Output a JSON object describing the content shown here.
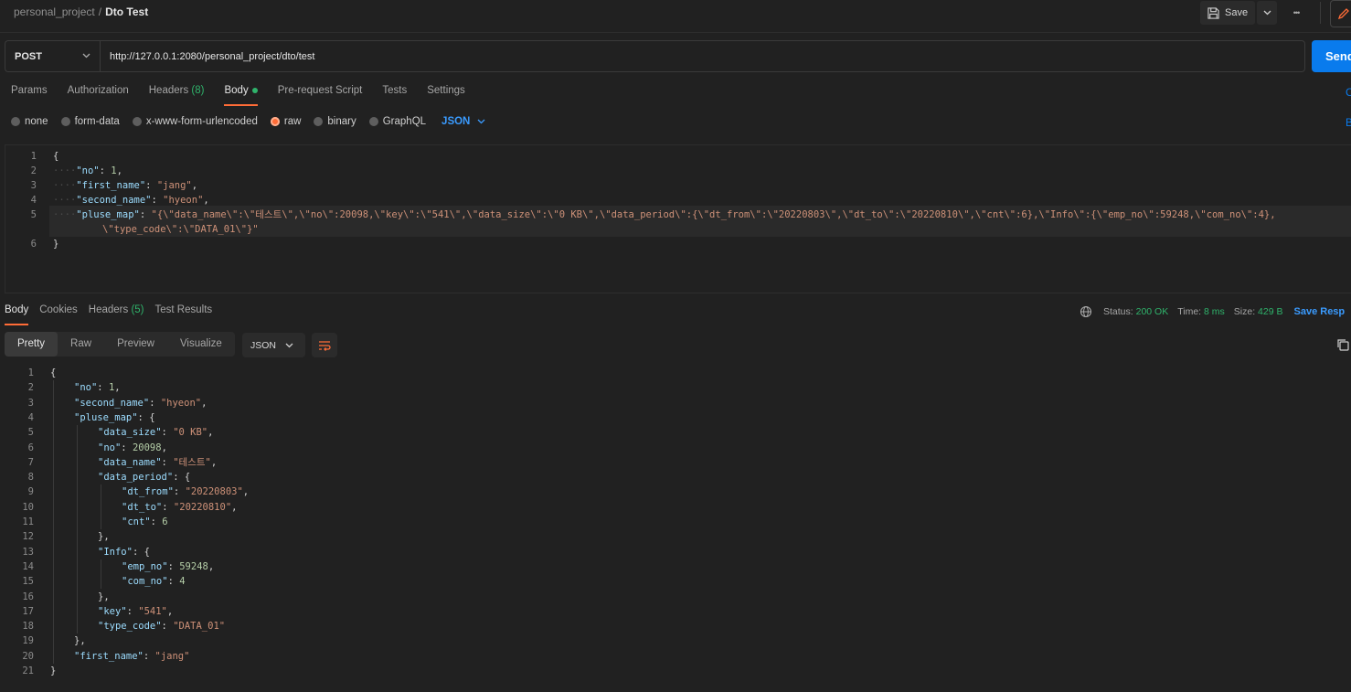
{
  "breadcrumb": {
    "workspace": "personal_project",
    "separator": "/",
    "request": "Dto Test"
  },
  "toolbar": {
    "save_label": "Save",
    "more_label": "•••"
  },
  "request": {
    "method": "POST",
    "url": "http://127.0.0.1:2080/personal_project/dto/test",
    "send_label": "Send"
  },
  "request_tabs": [
    {
      "label": "Params"
    },
    {
      "label": "Authorization"
    },
    {
      "label": "Headers",
      "count": "(8)"
    },
    {
      "label": "Body"
    },
    {
      "label": "Pre-request Script"
    },
    {
      "label": "Tests"
    },
    {
      "label": "Settings"
    }
  ],
  "request_tabs_right_clipped": "C",
  "body_types": [
    {
      "label": "none"
    },
    {
      "label": "form-data"
    },
    {
      "label": "x-www-form-urlencoded"
    },
    {
      "label": "raw"
    },
    {
      "label": "binary"
    },
    {
      "label": "GraphQL"
    }
  ],
  "body_format": "JSON",
  "body_types_right_clipped": "B",
  "request_body_lines": [
    {
      "n": "1",
      "text": "{"
    },
    {
      "n": "2",
      "key": "\"no\"",
      "value": "1",
      "vtype": "num",
      "tail": ","
    },
    {
      "n": "3",
      "key": "\"first_name\"",
      "value": "\"jang\"",
      "vtype": "str",
      "tail": ","
    },
    {
      "n": "4",
      "key": "\"second_name\"",
      "value": "\"hyeon\"",
      "vtype": "str",
      "tail": ","
    },
    {
      "n": "5",
      "key": "\"pluse_map\"",
      "value": "\"{\\\"data_name\\\":\\\"테스트\\\",\\\"no\\\":20098,\\\"key\\\":\\\"541\\\",\\\"data_size\\\":\\\"0 KB\\\",\\\"data_period\\\":{\\\"dt_from\\\":\\\"20220803\\\",\\\"dt_to\\\":\\\"20220810\\\",\\\"cnt\\\":6},\\\"Info\\\":{\\\"emp_no\\\":59248,\\\"com_no\\\":4},",
      "vtype": "str",
      "tail": ""
    },
    {
      "n": "",
      "wrap": "\\\"type_code\\\":\\\"DATA_01\\\"}\""
    },
    {
      "n": "6",
      "text": "}"
    }
  ],
  "response_tabs": [
    {
      "label": "Body"
    },
    {
      "label": "Cookies"
    },
    {
      "label": "Headers",
      "count": "(5)"
    },
    {
      "label": "Test Results"
    }
  ],
  "response_status": {
    "status_label": "Status:",
    "status_value": "200 OK",
    "time_label": "Time:",
    "time_value": "8 ms",
    "size_label": "Size:",
    "size_value": "429 B",
    "save_response_label": "Save Resp"
  },
  "response_views": [
    {
      "label": "Pretty"
    },
    {
      "label": "Raw"
    },
    {
      "label": "Preview"
    },
    {
      "label": "Visualize"
    }
  ],
  "response_format": "JSON",
  "response_body_lines": [
    {
      "n": "1",
      "indent": 0,
      "text": "{"
    },
    {
      "n": "2",
      "indent": 1,
      "key": "\"no\"",
      "value": "1",
      "vtype": "num",
      "tail": ","
    },
    {
      "n": "3",
      "indent": 1,
      "key": "\"second_name\"",
      "value": "\"hyeon\"",
      "vtype": "str",
      "tail": ","
    },
    {
      "n": "4",
      "indent": 1,
      "key": "\"pluse_map\"",
      "value": "{",
      "vtype": "punc",
      "tail": ""
    },
    {
      "n": "5",
      "indent": 2,
      "key": "\"data_size\"",
      "value": "\"0 KB\"",
      "vtype": "str",
      "tail": ","
    },
    {
      "n": "6",
      "indent": 2,
      "key": "\"no\"",
      "value": "20098",
      "vtype": "num",
      "tail": ","
    },
    {
      "n": "7",
      "indent": 2,
      "key": "\"data_name\"",
      "value": "\"테스트\"",
      "vtype": "str",
      "tail": ","
    },
    {
      "n": "8",
      "indent": 2,
      "key": "\"data_period\"",
      "value": "{",
      "vtype": "punc",
      "tail": ""
    },
    {
      "n": "9",
      "indent": 3,
      "key": "\"dt_from\"",
      "value": "\"20220803\"",
      "vtype": "str",
      "tail": ","
    },
    {
      "n": "10",
      "indent": 3,
      "key": "\"dt_to\"",
      "value": "\"20220810\"",
      "vtype": "str",
      "tail": ","
    },
    {
      "n": "11",
      "indent": 3,
      "key": "\"cnt\"",
      "value": "6",
      "vtype": "num",
      "tail": ""
    },
    {
      "n": "12",
      "indent": 2,
      "text": "},"
    },
    {
      "n": "13",
      "indent": 2,
      "key": "\"Info\"",
      "value": "{",
      "vtype": "punc",
      "tail": ""
    },
    {
      "n": "14",
      "indent": 3,
      "key": "\"emp_no\"",
      "value": "59248",
      "vtype": "num",
      "tail": ","
    },
    {
      "n": "15",
      "indent": 3,
      "key": "\"com_no\"",
      "value": "4",
      "vtype": "num",
      "tail": ""
    },
    {
      "n": "16",
      "indent": 2,
      "text": "},"
    },
    {
      "n": "17",
      "indent": 2,
      "key": "\"key\"",
      "value": "\"541\"",
      "vtype": "str",
      "tail": ","
    },
    {
      "n": "18",
      "indent": 2,
      "key": "\"type_code\"",
      "value": "\"DATA_01\"",
      "vtype": "str",
      "tail": ""
    },
    {
      "n": "19",
      "indent": 1,
      "text": "},"
    },
    {
      "n": "20",
      "indent": 1,
      "key": "\"first_name\"",
      "value": "\"jang\"",
      "vtype": "str",
      "tail": ""
    },
    {
      "n": "21",
      "indent": 0,
      "text": "}"
    }
  ],
  "colors": {
    "accent": "#ff6c37",
    "send": "#097bed",
    "link": "#3a9bff",
    "success": "#2fb36b",
    "key": "#9cdcfe",
    "string": "#ce9178",
    "number": "#b5cea8"
  },
  "icons": [
    "save-icon",
    "chevron-down-icon",
    "more-icon",
    "edit-icon",
    "globe-icon",
    "wrap-lines-icon",
    "copy-icon"
  ]
}
